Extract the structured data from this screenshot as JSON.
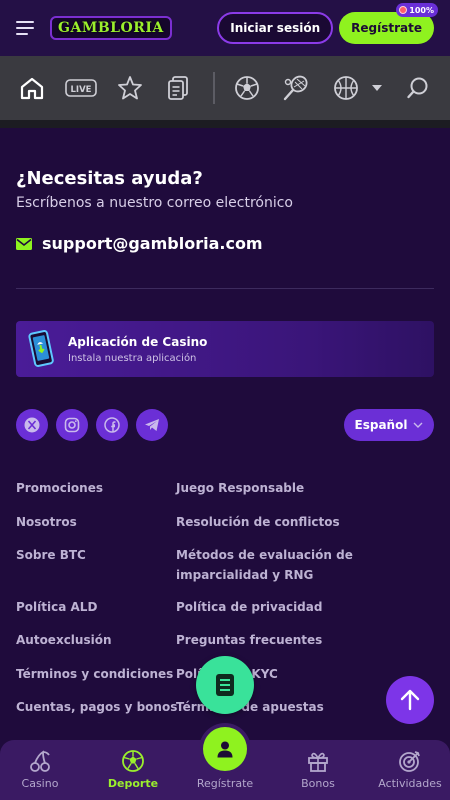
{
  "header": {
    "logo_text": "GAMBLORIA",
    "login_label": "Iniciar sesión",
    "register_label": "Regístrate",
    "badge_text": "100%"
  },
  "iconbar": {
    "items": [
      "home-icon",
      "live-icon",
      "star-icon",
      "betslip-icon",
      "soccer-icon",
      "tennis-icon",
      "basketball-icon",
      "chevron-down-icon",
      "search-icon"
    ],
    "live_label": "LIVE"
  },
  "help": {
    "title": "¿Necesitas ayuda?",
    "subtitle": "Escríbenos a nuestro correo electrónico",
    "email": "support@gambloria.com"
  },
  "app_card": {
    "title": "Aplicación de Casino",
    "subtitle": "Instala nuestra aplicación"
  },
  "socials": [
    "x-icon",
    "instagram-icon",
    "facebook-icon",
    "telegram-icon"
  ],
  "language": "Español",
  "footer_links": {
    "left": [
      "Promociones",
      "Nosotros",
      "Sobre BTC",
      "Política ALD",
      "Autoexclusión",
      "Términos y condiciones",
      "Cuentas, pagos y bonos"
    ],
    "right": [
      "Juego Responsable",
      "Resolución de conflictos",
      "Métodos de evaluación de imparcialidad y RNG",
      "Política de privacidad",
      "Preguntas frecuentes",
      "Política de KYC",
      "Términos de apuestas"
    ]
  },
  "bottom_nav": {
    "items": [
      {
        "label": "Casino",
        "icon": "cherries-icon"
      },
      {
        "label": "Deporte",
        "icon": "soccer-ball-icon",
        "active": true
      },
      {
        "label": "Regístrate",
        "icon": "user-icon"
      },
      {
        "label": "Bonos",
        "icon": "gift-icon"
      },
      {
        "label": "Actividades",
        "icon": "target-icon"
      }
    ]
  },
  "colors": {
    "background": "#1f0b3c",
    "accent_green": "#8ff21f",
    "accent_purple": "#6b2fd6",
    "fab_green": "#39e29a"
  }
}
